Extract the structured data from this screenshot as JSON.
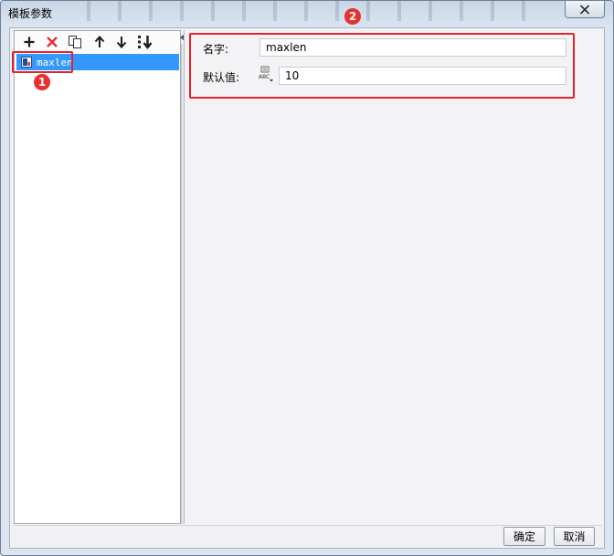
{
  "window": {
    "title": "模板参数",
    "close_glyph": "×"
  },
  "toolbar": {
    "icons": [
      "plus-icon",
      "delete-x-icon",
      "copy-icon",
      "arrow-up-icon",
      "arrow-down-icon",
      "sort-icon"
    ]
  },
  "tree": {
    "items": [
      {
        "label": "maxlen",
        "selected": true
      }
    ]
  },
  "form": {
    "name_label": "名字:",
    "name_value": "maxlen",
    "default_label": "默认值:",
    "default_value": "10",
    "type_icon_text": "ABC"
  },
  "annotations": {
    "badge1": "1",
    "badge2": "2",
    "color": "#e8222a"
  },
  "footer": {
    "ok_label": "确定",
    "cancel_label": "取消"
  }
}
